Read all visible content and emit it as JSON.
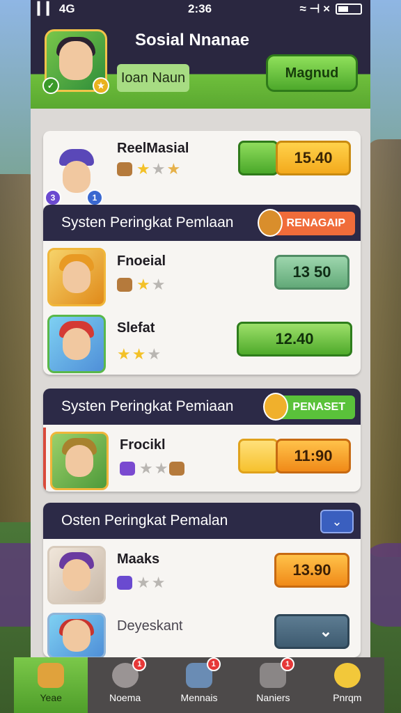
{
  "status": {
    "signal": "▎▎ 4G",
    "time": "2:36",
    "icons": "≈ ⊣ ×"
  },
  "header": {
    "title": "Sosial Nnanae",
    "player_name": "Ioan Naun",
    "action_label": "Magnud",
    "level_badge_left": "✓",
    "level_badge_right": "★"
  },
  "featured": {
    "name": "ReelMasial",
    "score": "15.40",
    "rating": 2,
    "badge_left": "3",
    "badge_right": "1"
  },
  "sections": [
    {
      "title": "Systen Peringkat Pemlaan",
      "tag": "RENAGAIP",
      "tag_color": "#f06c3a",
      "rows": [
        {
          "name": "Fnoeial",
          "score": "13 50",
          "rating": 1,
          "style": "mint"
        },
        {
          "name": "Slefat",
          "score": "12.40",
          "rating": 2,
          "style": "green"
        }
      ]
    },
    {
      "title": "Systen Peringkat Pemiaan",
      "tag": "PENASET",
      "tag_color": "#5ac23a",
      "rows": [
        {
          "name": "Frocikl",
          "score": "11:90",
          "rating": 0,
          "style": "orange"
        }
      ]
    },
    {
      "title": "Osten Peringkat Pemalan",
      "tag": "",
      "dropdown_icon": "chevron-down-icon",
      "rows": [
        {
          "name": "Maaks",
          "score": "13.90",
          "rating": 0,
          "style": "orange"
        },
        {
          "name": "Deyeskant",
          "score": "",
          "rating": 0,
          "style": "slate"
        }
      ]
    }
  ],
  "tabs": [
    {
      "label": "Yeae",
      "icon": "home-icon",
      "badge": ""
    },
    {
      "label": "Noema",
      "icon": "profile-icon",
      "badge": "1"
    },
    {
      "label": "Mennais",
      "icon": "helmet-icon",
      "badge": "1"
    },
    {
      "label": "Naniers",
      "icon": "shield-icon",
      "badge": "1"
    },
    {
      "label": "Pnrqm",
      "icon": "chat-icon",
      "badge": ""
    }
  ]
}
